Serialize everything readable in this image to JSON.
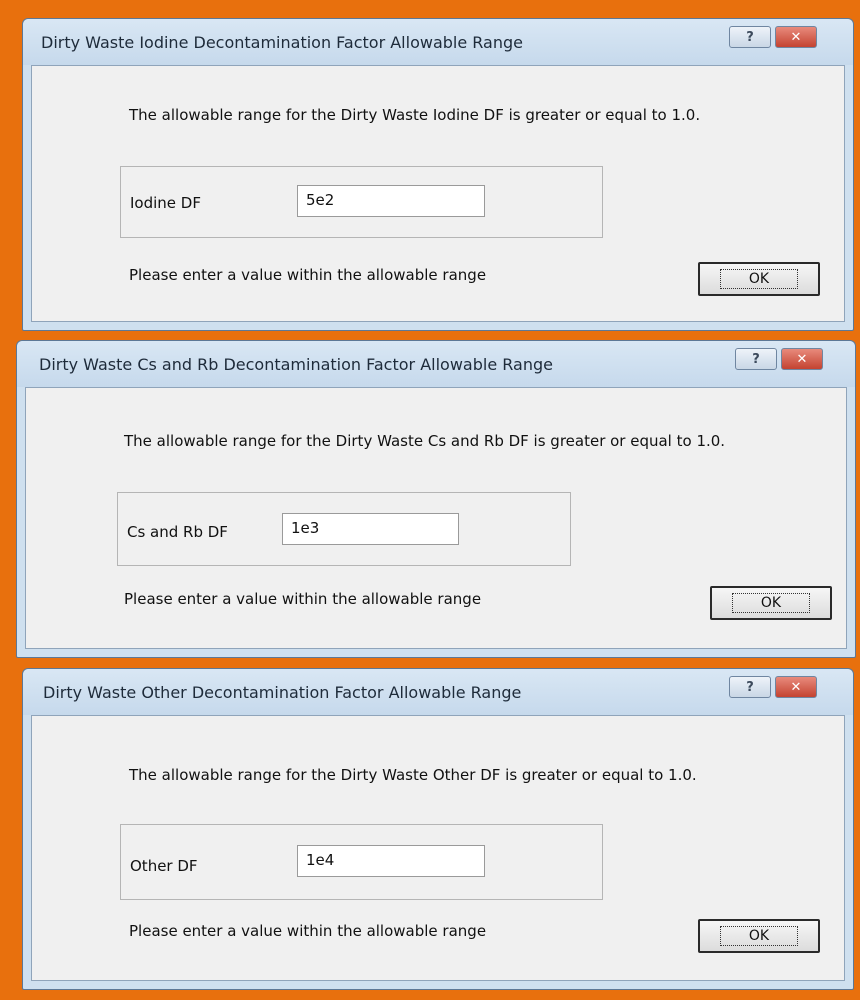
{
  "dialogs": [
    {
      "title": "Dirty Waste Iodine Decontamination Factor Allowable Range",
      "message": "The allowable range for the Dirty Waste Iodine DF is greater or equal to 1.0.",
      "field_label": "Iodine DF",
      "field_value": "5e2",
      "prompt": "Please enter a value within the allowable range",
      "ok_label": "OK",
      "help_label": "?",
      "close_label": "✕"
    },
    {
      "title": "Dirty Waste Cs and Rb Decontamination Factor Allowable Range",
      "message": "The allowable range for the Dirty Waste Cs and Rb DF is greater or equal to 1.0.",
      "field_label": "Cs and Rb DF",
      "field_value": "1e3",
      "prompt": "Please enter a value within the allowable range",
      "ok_label": "OK",
      "help_label": "?",
      "close_label": "✕"
    },
    {
      "title": "Dirty Waste Other Decontamination Factor Allowable Range",
      "message": "The allowable range for the Dirty Waste Other DF is greater or equal to 1.0.",
      "field_label": "Other DF",
      "field_value": "1e4",
      "prompt": "Please enter a value within the allowable range",
      "ok_label": "OK",
      "help_label": "?",
      "close_label": "✕"
    }
  ]
}
